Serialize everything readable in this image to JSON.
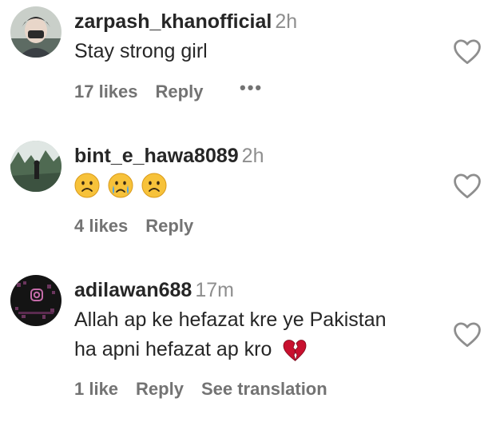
{
  "comments": [
    {
      "username": "zarpash_khanofficial",
      "time": "2h",
      "text": "Stay strong girl",
      "likes": "17 likes",
      "reply": "Reply",
      "more": "•••"
    },
    {
      "username": "bint_e_hawa8089",
      "time": "2h",
      "emojis": [
        "sad-face-emoji",
        "crying-face-emoji",
        "sad-face-emoji"
      ],
      "likes": "4 likes",
      "reply": "Reply"
    },
    {
      "username": "adilawan688",
      "time": "17m",
      "text_line1": "Allah ap ke hefazat kre ye Pakistan",
      "text_line2": "ha apni hefazat ap kro",
      "text_emoji": "broken-heart-emoji",
      "likes": "1 like",
      "reply": "Reply",
      "see_translation": "See translation"
    }
  ],
  "icons": {
    "like": "heart-outline-icon"
  },
  "colors": {
    "text": "#262626",
    "secondary": "#737373",
    "time": "#8e8e8e"
  }
}
